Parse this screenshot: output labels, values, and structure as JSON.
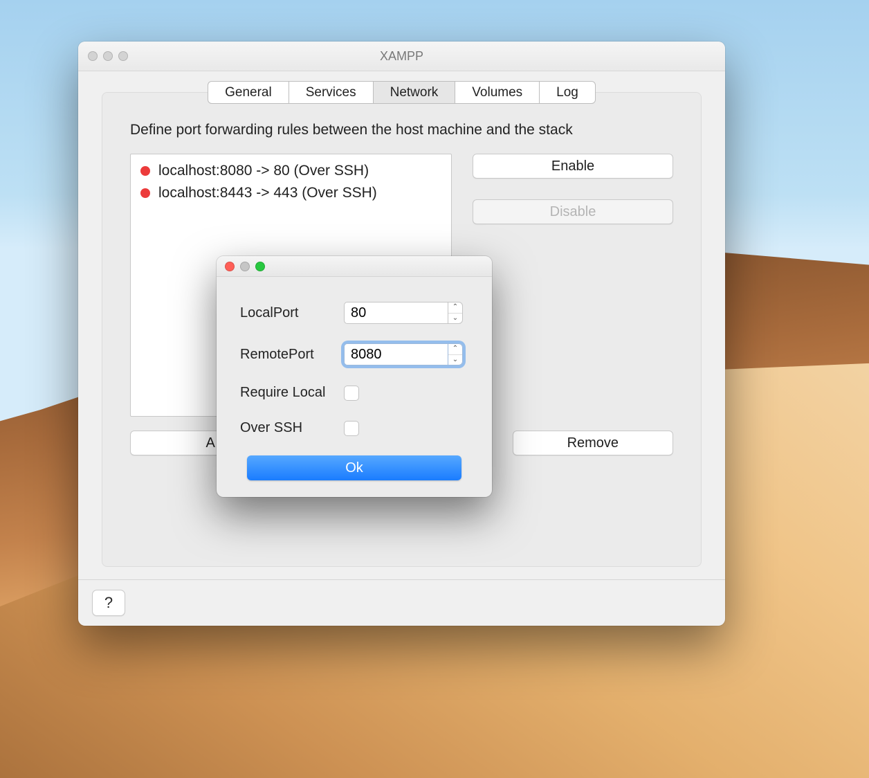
{
  "window": {
    "title": "XAMPP"
  },
  "tabs": [
    {
      "label": "General"
    },
    {
      "label": "Services"
    },
    {
      "label": "Network",
      "active": true
    },
    {
      "label": "Volumes"
    },
    {
      "label": "Log"
    }
  ],
  "network": {
    "description": "Define port forwarding rules between the host machine and the stack",
    "rules": [
      {
        "status_color": "#ec3b3b",
        "text": "localhost:8080 -> 80 (Over SSH)"
      },
      {
        "status_color": "#ec3b3b",
        "text": "localhost:8443 -> 443 (Over SSH)"
      }
    ],
    "buttons": {
      "enable": "Enable",
      "disable": "Disable",
      "add": "A",
      "remove": "Remove"
    }
  },
  "dialog": {
    "traffic": {
      "close": "#ff5f57",
      "min": "#c6c6c6",
      "zoom": "#28c840"
    },
    "fields": {
      "localport": {
        "label": "LocalPort",
        "value": "80"
      },
      "remoteport": {
        "label": "RemotePort",
        "value": "8080",
        "focused": true
      },
      "requirelocal": {
        "label": "Require Local",
        "checked": false
      },
      "overssh": {
        "label": "Over SSH",
        "checked": false
      }
    },
    "ok": "Ok"
  },
  "help": "?",
  "traffic_inactive_color": "#d3d3d3"
}
